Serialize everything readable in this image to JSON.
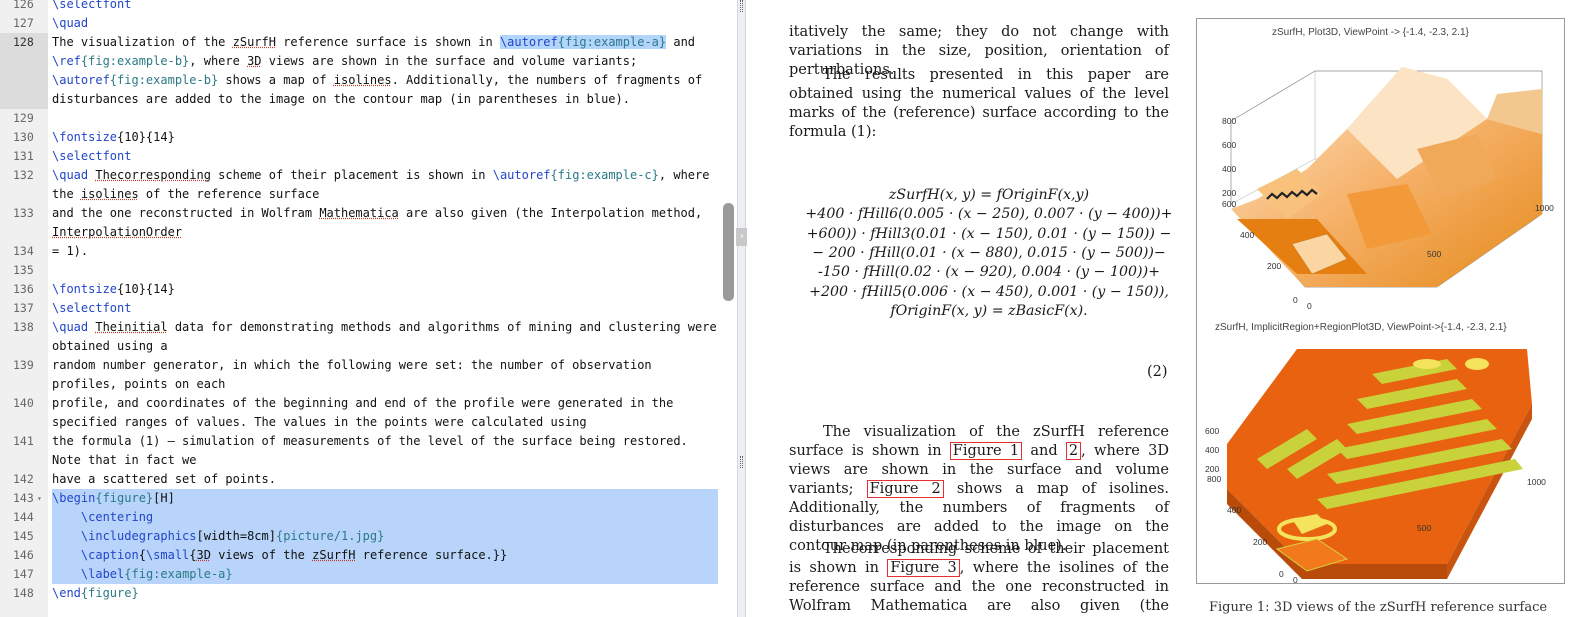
{
  "editor": {
    "lines": [
      {
        "n": "126",
        "segs": [
          [
            "cmd",
            "\\selectfont"
          ]
        ]
      },
      {
        "n": "127",
        "segs": [
          [
            "cmd",
            "\\quad"
          ]
        ]
      },
      {
        "n": "128",
        "segs": [
          [
            "t",
            "The visualization of the "
          ],
          [
            "wv",
            "zSurfH"
          ],
          [
            "t",
            " reference surface is shown in "
          ],
          [
            "hlcmd",
            "\\autoref"
          ],
          [
            "hlarg",
            "{fig:example-a}"
          ],
          [
            "t",
            " and"
          ]
        ]
      },
      {
        "n": "",
        "segs": [
          [
            "cmd",
            "\\ref"
          ],
          [
            "arg",
            "{fig:example-b}"
          ],
          [
            "t",
            ", where "
          ],
          [
            "wv",
            "3D"
          ],
          [
            "t",
            " views are shown in the surface and volume variants;"
          ]
        ]
      },
      {
        "n": "",
        "segs": [
          [
            "cmd",
            "\\autoref"
          ],
          [
            "arg",
            "{fig:example-b}"
          ],
          [
            "t",
            " shows a map of "
          ],
          [
            "wv",
            "isolines"
          ],
          [
            "t",
            ". Additionally, the numbers of fragments of"
          ]
        ]
      },
      {
        "n": "",
        "segs": [
          [
            "t",
            "disturbances are added to the image on the contour map (in parentheses in blue)."
          ]
        ]
      },
      {
        "n": "129",
        "segs": []
      },
      {
        "n": "130",
        "segs": [
          [
            "cmd",
            "\\fontsize"
          ],
          [
            "t",
            "{10}{14}"
          ]
        ]
      },
      {
        "n": "131",
        "segs": [
          [
            "cmd",
            "\\selectfont"
          ]
        ]
      },
      {
        "n": "132",
        "segs": [
          [
            "cmd",
            "\\quad "
          ],
          [
            "wv",
            "Thecorresponding"
          ],
          [
            "t",
            " scheme of their placement is shown in "
          ],
          [
            "cmd",
            "\\autoref"
          ],
          [
            "arg",
            "{fig:example-c}"
          ],
          [
            "t",
            ", where"
          ]
        ]
      },
      {
        "n": "",
        "segs": [
          [
            "t",
            "the "
          ],
          [
            "wv",
            "isolines"
          ],
          [
            "t",
            " of the reference surface"
          ]
        ]
      },
      {
        "n": "133",
        "segs": [
          [
            "t",
            "and the one reconstructed in Wolfram "
          ],
          [
            "wv",
            "Mathematica"
          ],
          [
            "t",
            " are also given (the Interpolation method,"
          ]
        ]
      },
      {
        "n": "",
        "segs": [
          [
            "wv",
            "InterpolationOrder"
          ]
        ]
      },
      {
        "n": "134",
        "segs": [
          [
            "t",
            "= 1)."
          ]
        ]
      },
      {
        "n": "135",
        "segs": []
      },
      {
        "n": "136",
        "segs": [
          [
            "cmd",
            "\\fontsize"
          ],
          [
            "t",
            "{10}{14}"
          ]
        ]
      },
      {
        "n": "137",
        "segs": [
          [
            "cmd",
            "\\selectfont"
          ]
        ]
      },
      {
        "n": "138",
        "segs": [
          [
            "cmd",
            "\\quad "
          ],
          [
            "wv",
            "Theinitial"
          ],
          [
            "t",
            " data for demonstrating methods and algorithms of mining and clustering were"
          ]
        ]
      },
      {
        "n": "",
        "segs": [
          [
            "t",
            "obtained using a"
          ]
        ]
      },
      {
        "n": "139",
        "segs": [
          [
            "t",
            "random number generator, in which the following were set: the number of observation"
          ]
        ]
      },
      {
        "n": "",
        "segs": [
          [
            "t",
            "profiles, points on each"
          ]
        ]
      },
      {
        "n": "140",
        "segs": [
          [
            "t",
            "profile, and coordinates of the beginning and end of the profile were generated in the"
          ]
        ]
      },
      {
        "n": "",
        "segs": [
          [
            "t",
            "specified ranges of values. The values in the points were calculated using"
          ]
        ]
      },
      {
        "n": "141",
        "segs": [
          [
            "t",
            "the formula (1) – simulation of measurements of the level of the surface being restored."
          ]
        ]
      },
      {
        "n": "",
        "segs": [
          [
            "t",
            "Note that in fact we"
          ]
        ]
      },
      {
        "n": "142",
        "segs": [
          [
            "t",
            "have a scattered set of points."
          ]
        ]
      },
      {
        "n": "143",
        "segs": [
          [
            "cmd",
            "\\begin"
          ],
          [
            "arg",
            "{figure}"
          ],
          [
            "t",
            "[H]"
          ]
        ]
      },
      {
        "n": "144",
        "segs": [
          [
            "t",
            "    "
          ],
          [
            "cmd",
            "\\centering"
          ]
        ]
      },
      {
        "n": "145",
        "segs": [
          [
            "t",
            "    "
          ],
          [
            "cmd",
            "\\includegraphics"
          ],
          [
            "t",
            "[width=8cm]"
          ],
          [
            "arg",
            "{picture/1.jpg}"
          ]
        ]
      },
      {
        "n": "146",
        "segs": [
          [
            "t",
            "    "
          ],
          [
            "cmd",
            "\\caption"
          ],
          [
            "t",
            "{"
          ],
          [
            "cmd",
            "\\small"
          ],
          [
            "t",
            "{"
          ],
          [
            "wv",
            "3D"
          ],
          [
            "t",
            " views of the "
          ],
          [
            "wv",
            "zSurfH"
          ],
          [
            "t",
            " reference surface.}}"
          ]
        ]
      },
      {
        "n": "147",
        "segs": [
          [
            "t",
            "    "
          ],
          [
            "cmd",
            "\\label"
          ],
          [
            "arg",
            "{fig:example-a}"
          ]
        ]
      },
      {
        "n": "148",
        "segs": [
          [
            "cmd",
            "\\end"
          ],
          [
            "arg",
            "{figure}"
          ]
        ]
      }
    ],
    "fold_marker": "▾"
  },
  "pdf": {
    "para_top": "itatively the same; they do not change with variations in the size, position, orientation of perturbations.",
    "para_results": "The results presented in this paper are obtained using the numerical values of the level marks of the (reference) surface according to the formula (1):",
    "equation": [
      "zSurfH(x, y) = fOriginF(x,y)",
      "+400 · fHill6(0.005 · (x − 250), 0.007 · (y − 400))+",
      "+600)) · fHill3(0.01 · (x − 150), 0.01 · (y − 150)) −",
      "− 200 · fHill(0.01 · (x − 880), 0.015 · (y − 500))−",
      "-150 · fHill(0.02 · (x − 920), 0.004 · (y − 100))+",
      "+200 · fHill5(0.006 · (x − 450), 0.001 · (y − 150)),",
      "fOriginF(x, y) = zBasicF(x)."
    ],
    "equation_number": "(2)",
    "para_vis": {
      "a": "The visualization of the zSurfH reference surface is shown in ",
      "ref1": "Figure 1",
      "b": " and ",
      "ref2": "2",
      "c": ", where 3D views are shown in the surface and volume variants; ",
      "ref3": "Figure 2",
      "d": " shows a map of isolines. Additionally, the numbers of fragments of disturbances are added to the image on the contour map (in parentheses in blue)."
    },
    "para_scheme": {
      "a": "Thecorresponding scheme of their placement is shown in ",
      "ref1": "Figure 3",
      "b": ", where the isolines of the reference surface and the one reconstructed in Wolfram Mathematica are also given (the Interpolation method, Inter-"
    },
    "figure": {
      "title_top": "zSurfH, Plot3D, ViewPoint -> {-1.4, -2.3, 2.1}",
      "title_bottom": "zSurfH, ImplicitRegion+RegionPlot3D, ViewPoint->{-1.4, -2.3, 2.1}",
      "top_axes": [
        "800",
        "600",
        "400",
        "200",
        "600",
        "400",
        "200",
        "0",
        "0",
        "500",
        "1000"
      ],
      "bottom_axes": [
        "600",
        "400",
        "200",
        "800",
        "400",
        "200",
        "0",
        "0",
        "500",
        "1000"
      ]
    },
    "caption_peek": "Figure 1: 3D views of the zSurfH reference surface"
  }
}
